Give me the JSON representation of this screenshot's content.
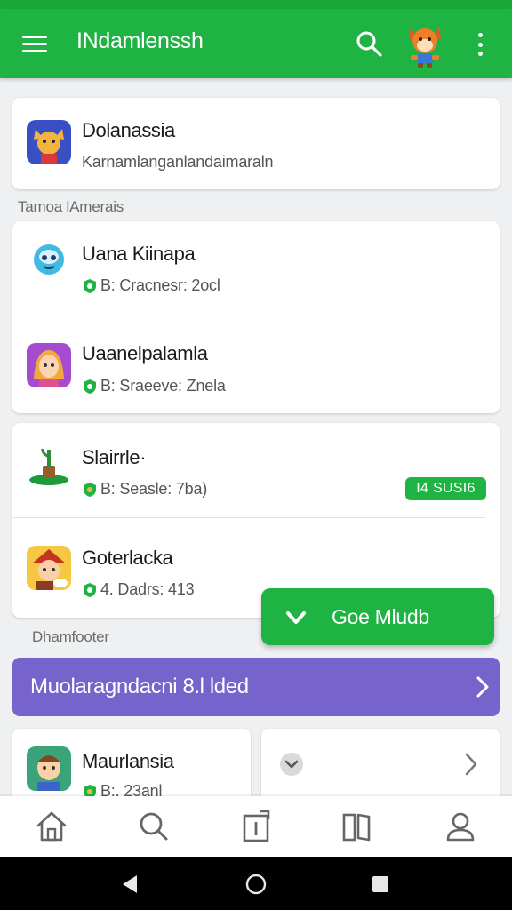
{
  "app_bar": {
    "title": "INdamlenssh",
    "menu_icon": "hamburger-menu-icon",
    "search_icon": "search-icon",
    "avatar": "fox-avatar",
    "more_icon": "more-vert-icon"
  },
  "featured": {
    "title": "Dolanassia",
    "subtitle": "Karnamlanganlandaimaraln"
  },
  "sections": {
    "first_label": "Tamoa lAmerais",
    "second_label": "Dhamfooter"
  },
  "items": [
    {
      "title": "Uana Kiinapa",
      "meta": "B: Cracnesr: 2ocl"
    },
    {
      "title": "Uaanelpalamla",
      "meta": "B: Sraeeve: Znela"
    },
    {
      "title": "Slairrle·",
      "meta": "B: Seasle: 7ba)",
      "badge": "I4 SUSI6"
    },
    {
      "title": "Goterlacka",
      "meta": "4. Dadrs: 413"
    }
  ],
  "fab": {
    "label": "Goe Mludb"
  },
  "promo": {
    "label": "Muolaragndacni 8.l lded"
  },
  "bottom_cards": {
    "left": {
      "title": "Maurlansia",
      "meta": "B:, 23anl"
    }
  },
  "colors": {
    "primary": "#1fb343",
    "promo": "#7664cc",
    "background": "#eef0f1"
  },
  "bottom_nav": [
    "home-icon",
    "search-icon",
    "tasks-icon",
    "library-icon",
    "profile-icon"
  ],
  "system_nav": [
    "back-icon",
    "home-circle-icon",
    "recents-icon"
  ]
}
